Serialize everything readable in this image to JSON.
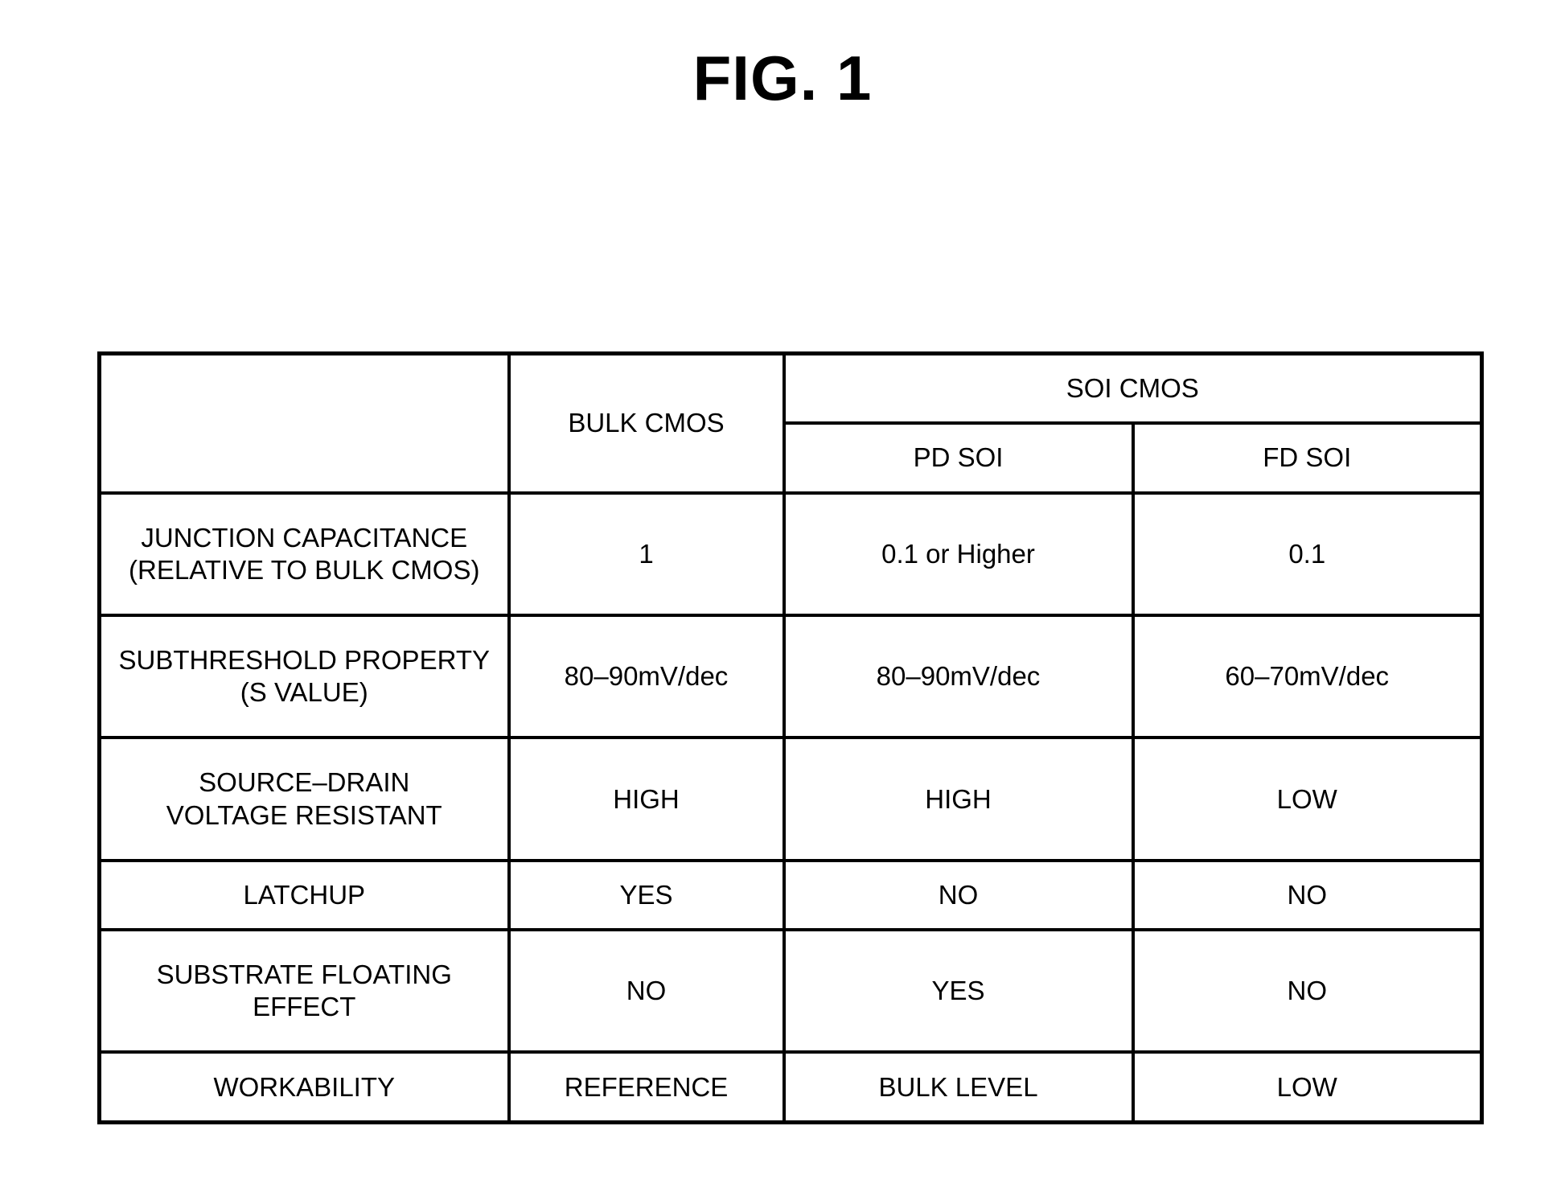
{
  "figure": {
    "title": "FIG. 1"
  },
  "table": {
    "header": {
      "corner_label": "",
      "bulk_label": "BULK CMOS",
      "soi_group_label": "SOI  CMOS",
      "pd_label": "PD  SOI",
      "fd_label": "FD  SOI"
    },
    "columns": [
      "",
      "BULK CMOS",
      "PD  SOI",
      "FD  SOI"
    ],
    "rows": [
      {
        "label_line1": "JUNCTION CAPACITANCE",
        "label_line2": "(RELATIVE TO BULK CMOS)",
        "bulk": "1",
        "pd": "0.1 or Higher",
        "fd": "0.1"
      },
      {
        "label_line1": "SUBTHRESHOLD PROPERTY",
        "label_line2": "(S VALUE)",
        "bulk": "80‒90mV/dec",
        "pd": "80‒90mV/dec",
        "fd": "60‒70mV/dec"
      },
      {
        "label_line1": "SOURCE‒DRAIN",
        "label_line2": "VOLTAGE RESISTANT",
        "bulk": "HIGH",
        "pd": "HIGH",
        "fd": "LOW"
      },
      {
        "label_line1": "LATCHUP",
        "label_line2": "",
        "bulk": "YES",
        "pd": "NO",
        "fd": "NO"
      },
      {
        "label_line1": "SUBSTRATE FLOATING",
        "label_line2": "EFFECT",
        "bulk": "NO",
        "pd": "YES",
        "fd": "NO"
      },
      {
        "label_line1": "WORKABILITY",
        "label_line2": "",
        "bulk": "REFERENCE",
        "pd": "BULK LEVEL",
        "fd": "LOW"
      }
    ]
  },
  "colors": {
    "line": "#000000",
    "text": "#000000",
    "background": "#ffffff"
  }
}
